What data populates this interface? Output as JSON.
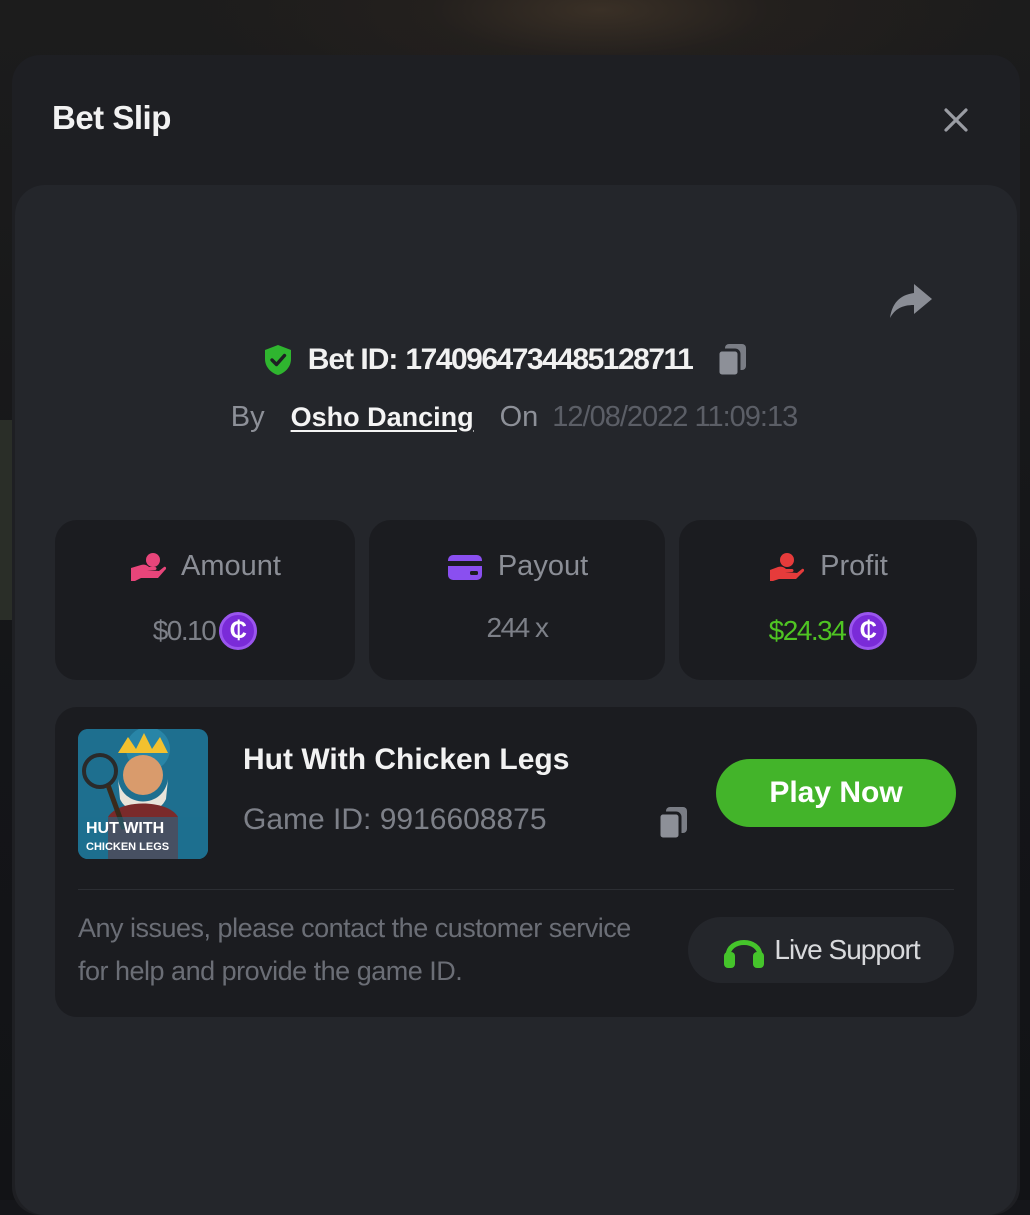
{
  "modal": {
    "title": "Bet Slip"
  },
  "bet": {
    "id_label": "Bet ID:",
    "id_value": "1740964734485128711",
    "by_label": "By",
    "user_name": "Osho Dancing",
    "on_label": "On",
    "datetime": "12/08/2022 11:09:13"
  },
  "stats": [
    {
      "label": "Amount",
      "value": "$0.10",
      "icon": "hand-coins-icon",
      "icon_color": "#e8457a",
      "value_color": "#7d8088",
      "coin": "₵"
    },
    {
      "label": "Payout",
      "value": "244 x",
      "icon": "wallet-card-icon",
      "icon_color": "#8a4ff0",
      "value_color": "#7d8088"
    },
    {
      "label": "Profit",
      "value": "$24.34",
      "icon": "hand-profit-icon",
      "icon_color": "#e63b3b",
      "value_color": "#4fc423",
      "coin": "₵"
    }
  ],
  "game": {
    "title": "Hut With Chicken Legs",
    "id_text": "Game ID: 9916608875",
    "thumb_text_line1": "HUT WITH",
    "thumb_text_line2": "CHICKEN LEGS",
    "play_label": "Play Now"
  },
  "support": {
    "text": "Any issues, please contact the customer service for help and provide the game ID.",
    "button_label": "Live Support"
  },
  "colors": {
    "accent_green": "#43b42a",
    "coin_purple": "#7a2bd8",
    "shield_green": "#2fb52f"
  }
}
